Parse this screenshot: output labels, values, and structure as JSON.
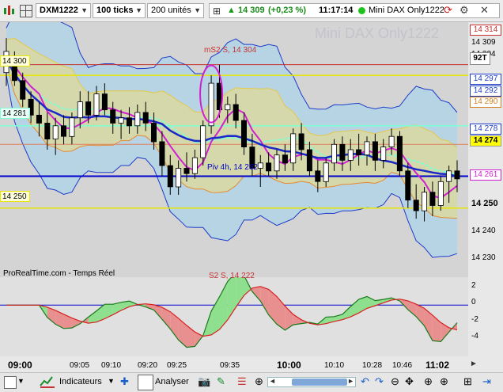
{
  "toolbar": {
    "instrument": "DXM1222",
    "interval": "100 ticks",
    "units": "200 unités",
    "price": "14 309",
    "change": "(+0,23 %)",
    "time": "11:17:14",
    "market": "Mini DAX Only1222"
  },
  "chart": {
    "watermark": "Mini DAX Only1222",
    "source_label": "ProRealTime.com - Temps Réel",
    "badge": "92T",
    "annotations": {
      "ms2": "mS2 S, 14 304",
      "piv": "Piv 4h, 14 262",
      "s2": "S2 S, 14 222"
    },
    "left_labels": [
      "14 300",
      "14 281",
      "14 250"
    ],
    "price_axis": [
      "14 314",
      "14 309",
      "14 304",
      "14 297",
      "14 292",
      "14 290",
      "14 278",
      "14 274",
      "14 261",
      "14 250",
      "14 240",
      "14 230"
    ],
    "colors": {
      "up_candle": "#ffffff",
      "down_candle": "#000000",
      "pivot_line": "#0000cc",
      "red_level": "#c83232",
      "yellow_level": "#e6e600",
      "cyan_ma": "#7fffd4",
      "magenta_ma": "#d020d0",
      "bollinger": "#1e3cc8"
    }
  },
  "indicator": {
    "axis": [
      "2",
      "0",
      "-2",
      "-4"
    ]
  },
  "time_axis": [
    "09:00",
    "09:05",
    "09:10",
    "09:20",
    "09:25",
    "09:35",
    "10:00",
    "10:10",
    "10:28",
    "10:46",
    "11:02"
  ],
  "bottom_bar": {
    "indicators_label": "Indicateurs",
    "analyze_label": "Analyser"
  },
  "chart_data": {
    "type": "candlestick",
    "ylim": [
      14224,
      14320
    ],
    "candles": [
      {
        "o": 14301,
        "h": 14314,
        "l": 14296,
        "c": 14309
      },
      {
        "o": 14306,
        "h": 14309,
        "l": 14296,
        "c": 14298
      },
      {
        "o": 14298,
        "h": 14301,
        "l": 14288,
        "c": 14291
      },
      {
        "o": 14291,
        "h": 14294,
        "l": 14282,
        "c": 14285
      },
      {
        "o": 14285,
        "h": 14290,
        "l": 14277,
        "c": 14282
      },
      {
        "o": 14282,
        "h": 14286,
        "l": 14272,
        "c": 14276
      },
      {
        "o": 14276,
        "h": 14284,
        "l": 14270,
        "c": 14281
      },
      {
        "o": 14281,
        "h": 14285,
        "l": 14274,
        "c": 14277
      },
      {
        "o": 14277,
        "h": 14286,
        "l": 14274,
        "c": 14284
      },
      {
        "o": 14284,
        "h": 14294,
        "l": 14280,
        "c": 14290
      },
      {
        "o": 14290,
        "h": 14294,
        "l": 14282,
        "c": 14285
      },
      {
        "o": 14285,
        "h": 14296,
        "l": 14283,
        "c": 14293
      },
      {
        "o": 14293,
        "h": 14297,
        "l": 14285,
        "c": 14287
      },
      {
        "o": 14287,
        "h": 14290,
        "l": 14278,
        "c": 14282
      },
      {
        "o": 14282,
        "h": 14287,
        "l": 14276,
        "c": 14284
      },
      {
        "o": 14284,
        "h": 14288,
        "l": 14278,
        "c": 14281
      },
      {
        "o": 14281,
        "h": 14289,
        "l": 14278,
        "c": 14286
      },
      {
        "o": 14286,
        "h": 14290,
        "l": 14279,
        "c": 14282
      },
      {
        "o": 14282,
        "h": 14286,
        "l": 14272,
        "c": 14275
      },
      {
        "o": 14275,
        "h": 14279,
        "l": 14262,
        "c": 14266
      },
      {
        "o": 14266,
        "h": 14270,
        "l": 14255,
        "c": 14258
      },
      {
        "o": 14258,
        "h": 14268,
        "l": 14255,
        "c": 14265
      },
      {
        "o": 14265,
        "h": 14271,
        "l": 14260,
        "c": 14263
      },
      {
        "o": 14263,
        "h": 14272,
        "l": 14261,
        "c": 14269
      },
      {
        "o": 14269,
        "h": 14283,
        "l": 14266,
        "c": 14281
      },
      {
        "o": 14281,
        "h": 14300,
        "l": 14278,
        "c": 14297
      },
      {
        "o": 14297,
        "h": 14304,
        "l": 14284,
        "c": 14287
      },
      {
        "o": 14287,
        "h": 14292,
        "l": 14282,
        "c": 14289
      },
      {
        "o": 14289,
        "h": 14293,
        "l": 14280,
        "c": 14283
      },
      {
        "o": 14283,
        "h": 14286,
        "l": 14270,
        "c": 14273
      },
      {
        "o": 14273,
        "h": 14278,
        "l": 14262,
        "c": 14265
      },
      {
        "o": 14265,
        "h": 14270,
        "l": 14258,
        "c": 14267
      },
      {
        "o": 14267,
        "h": 14271,
        "l": 14262,
        "c": 14264
      },
      {
        "o": 14264,
        "h": 14272,
        "l": 14261,
        "c": 14270
      },
      {
        "o": 14270,
        "h": 14274,
        "l": 14264,
        "c": 14267
      },
      {
        "o": 14267,
        "h": 14280,
        "l": 14264,
        "c": 14278
      },
      {
        "o": 14278,
        "h": 14282,
        "l": 14268,
        "c": 14272
      },
      {
        "o": 14272,
        "h": 14275,
        "l": 14262,
        "c": 14264
      },
      {
        "o": 14264,
        "h": 14268,
        "l": 14256,
        "c": 14260
      },
      {
        "o": 14260,
        "h": 14269,
        "l": 14258,
        "c": 14267
      },
      {
        "o": 14267,
        "h": 14276,
        "l": 14264,
        "c": 14274
      },
      {
        "o": 14274,
        "h": 14277,
        "l": 14264,
        "c": 14268
      },
      {
        "o": 14268,
        "h": 14276,
        "l": 14264,
        "c": 14272
      },
      {
        "o": 14272,
        "h": 14278,
        "l": 14266,
        "c": 14270
      },
      {
        "o": 14270,
        "h": 14277,
        "l": 14266,
        "c": 14275
      },
      {
        "o": 14275,
        "h": 14278,
        "l": 14264,
        "c": 14268
      },
      {
        "o": 14268,
        "h": 14276,
        "l": 14265,
        "c": 14273
      },
      {
        "o": 14273,
        "h": 14280,
        "l": 14270,
        "c": 14277
      },
      {
        "o": 14277,
        "h": 14279,
        "l": 14262,
        "c": 14264
      },
      {
        "o": 14264,
        "h": 14267,
        "l": 14250,
        "c": 14253
      },
      {
        "o": 14253,
        "h": 14259,
        "l": 14246,
        "c": 14249
      },
      {
        "o": 14249,
        "h": 14258,
        "l": 14245,
        "c": 14256
      },
      {
        "o": 14256,
        "h": 14260,
        "l": 14247,
        "c": 14251
      },
      {
        "o": 14251,
        "h": 14262,
        "l": 14249,
        "c": 14260
      },
      {
        "o": 14260,
        "h": 14266,
        "l": 14252,
        "c": 14264
      },
      {
        "o": 14264,
        "h": 14268,
        "l": 14256,
        "c": 14261
      }
    ],
    "levels": [
      14304,
      14300,
      14281,
      14274,
      14262,
      14250
    ],
    "indicator_ylim": [
      -5.5,
      3
    ]
  }
}
